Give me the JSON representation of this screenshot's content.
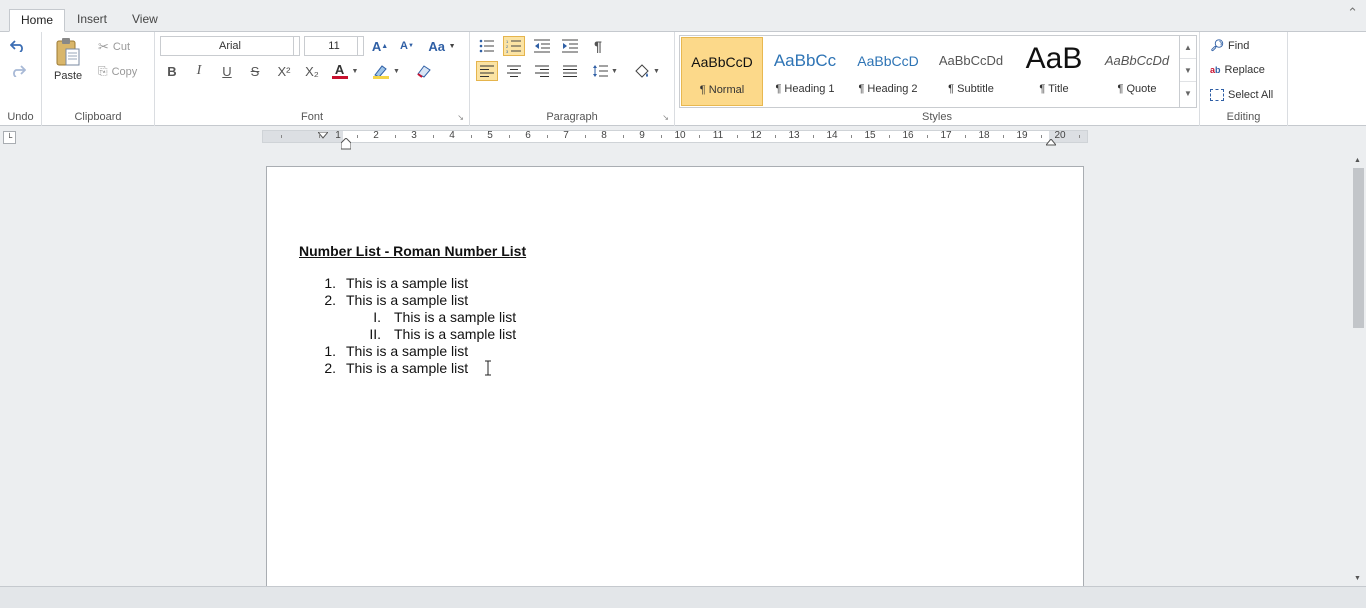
{
  "tabs": [
    {
      "label": "Home",
      "active": true
    },
    {
      "label": "Insert",
      "active": false
    },
    {
      "label": "View",
      "active": false
    }
  ],
  "ribbon": {
    "undo_group": {
      "label": "Undo"
    },
    "clipboard": {
      "label": "Clipboard",
      "paste": "Paste",
      "cut": "Cut",
      "copy": "Copy"
    },
    "font": {
      "label": "Font",
      "family": "Arial",
      "size": "11",
      "bold": "B",
      "italic": "I",
      "underline": "U",
      "strike": "S",
      "superscript": "X²",
      "subscript": "X₂",
      "font_color": "A",
      "grow": "A",
      "shrink": "A",
      "change_case": "Aa"
    },
    "paragraph": {
      "label": "Paragraph",
      "show_marks": "¶"
    },
    "styles": {
      "label": "Styles",
      "items": [
        {
          "sample": "AaBbCcD",
          "name": "¶ Normal",
          "selected": true
        },
        {
          "sample": "AaBbCc",
          "name": "¶ Heading 1",
          "selected": false
        },
        {
          "sample": "AaBbCcD",
          "name": "¶ Heading 2",
          "selected": false
        },
        {
          "sample": "AaBbCcDd",
          "name": "¶ Subtitle",
          "selected": false
        },
        {
          "sample": "AaB",
          "name": "¶ Title",
          "selected": false
        },
        {
          "sample": "AaBbCcDd",
          "name": "¶ Quote",
          "selected": false
        }
      ]
    },
    "editing": {
      "label": "Editing",
      "find": "Find",
      "replace": "Replace",
      "select_all": "Select All"
    }
  },
  "ruler": {
    "labels": [
      "1",
      "2",
      "3",
      "4",
      "5",
      "6",
      "7",
      "8",
      "9",
      "10",
      "11",
      "12",
      "13",
      "14",
      "15",
      "16",
      "17",
      "18",
      "19",
      "20"
    ]
  },
  "document": {
    "title": "Number List - Roman Number List",
    "lines": [
      {
        "num": "1.",
        "text": "This is a sample list",
        "level": 1
      },
      {
        "num": "2.",
        "text": "This is a sample list",
        "level": 1
      },
      {
        "num": "I.",
        "text": "This is a sample list",
        "level": 2
      },
      {
        "num": "II.",
        "text": "This is a sample list",
        "level": 2
      },
      {
        "num": "1.",
        "text": "This is a sample list",
        "level": 1
      },
      {
        "num": "2.",
        "text": "This is a sample list",
        "level": 1
      }
    ]
  },
  "colors": {
    "accent_selected": "#fcd98a",
    "accent_border": "#e8b850",
    "icon_blue": "#3c6eb4"
  }
}
